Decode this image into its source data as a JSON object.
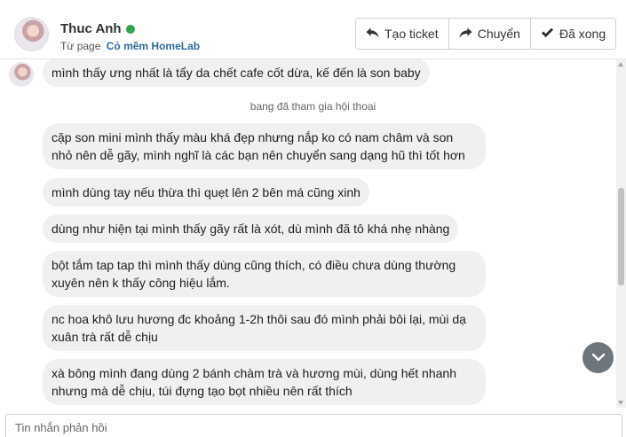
{
  "header": {
    "user_name": "Thuc Anh",
    "page_prefix": "Từ page",
    "page_name": "Cỏ mềm HomeLab",
    "status_color": "#31a24c",
    "actions": {
      "create_ticket": "Tạo ticket",
      "transfer": "Chuyển",
      "done": "Đã xong"
    },
    "icons": [
      "reply-arrow-icon",
      "forward-arrow-icon",
      "checkmark-icon"
    ]
  },
  "chat": {
    "first_message": "mình thấy ưng nhất là tẩy da chết cafe cốt dừa, kế đến là son baby",
    "system_note": "bang đã tham gia hội thoại",
    "messages": [
      {
        "line1": "cặp son mini mình thấy màu khá đẹp nhưng nắp ko có nam châm và son",
        "line2": "nhỏ nên dễ gãy, mình nghĩ là các bạn nên chuyển sang dạng hũ thì tốt hơn"
      },
      {
        "line1": "mình dùng tay nếu thừa thì quẹt lên 2 bên má cũng xinh",
        "line2": ""
      },
      {
        "line1": "dùng như hiện tại mình thấy gãy rất là xót, dù mình đã tô khá nhẹ nhàng",
        "line2": ""
      },
      {
        "line1": "bột tắm tap tap thì mình thấy dùng cũng thích, có điều chưa dùng thường",
        "line2": "xuyên nên k thấy công hiệu lắm."
      },
      {
        "line1": "nc hoa khô lưu hương đc khoảng 1-2h thôi sau đó mình phải bôi lại, mùi dạ",
        "line2": "xuân trà rất dễ chịu"
      },
      {
        "line1": "xà bông mình đang dùng 2 bánh chàm trà và hương mùi, dùng hết nhanh",
        "line2": "nhưng mà dễ chịu, túi đựng tạo bọt nhiều nên rất thích"
      }
    ]
  },
  "reply": {
    "placeholder": "Tin nhắn phản hồi"
  }
}
